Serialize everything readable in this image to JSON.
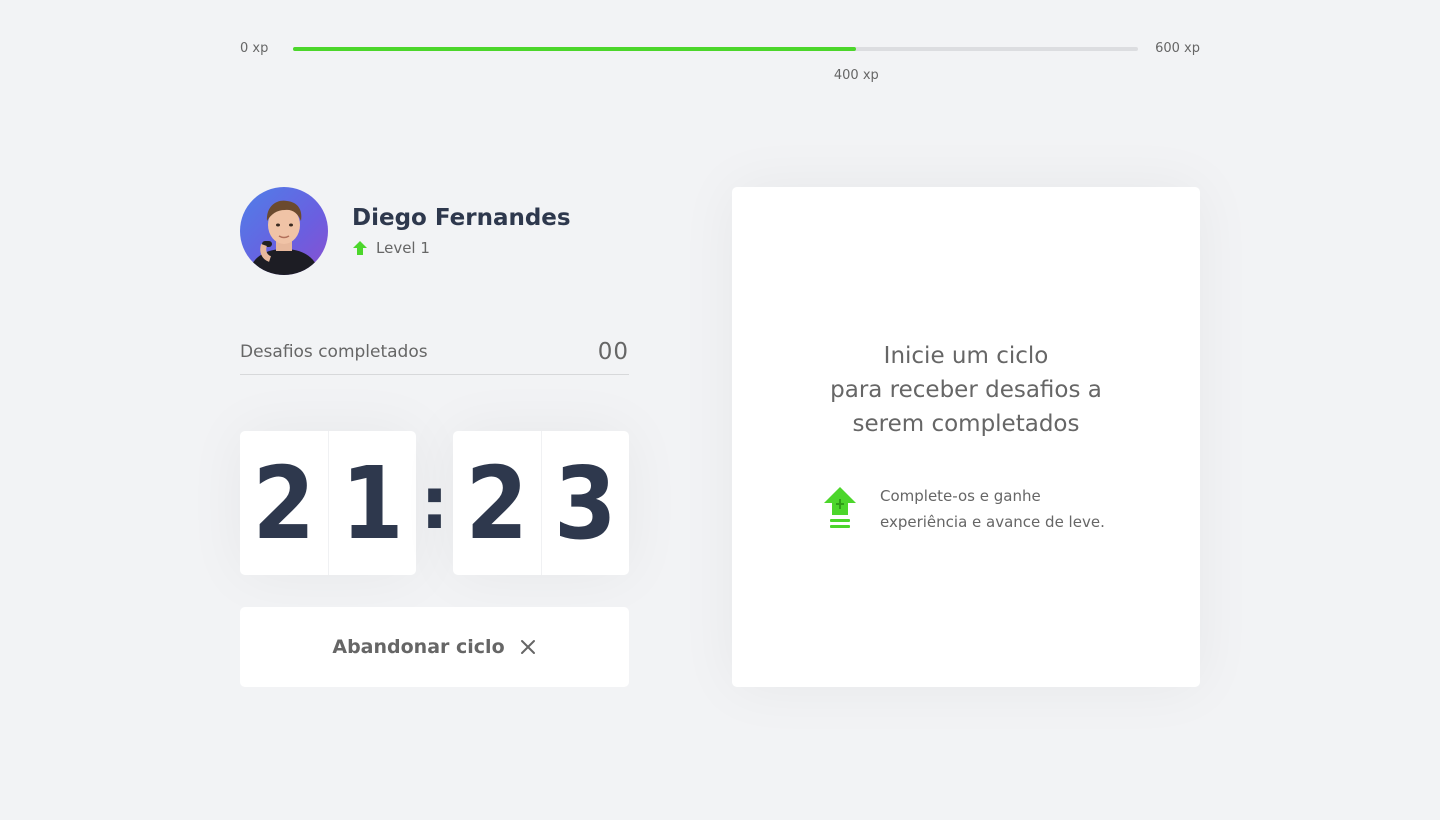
{
  "xp_bar": {
    "min_label": "0 xp",
    "max_label": "600 xp",
    "current_label": "400 xp",
    "current_xp": 400,
    "max_xp": 600,
    "progress_fraction": 0.6667,
    "fill_color": "#4cd62b"
  },
  "profile": {
    "name": "Diego Fernandes",
    "level_label": "Level 1",
    "level_icon": "level-up-arrow-icon"
  },
  "completed_challenges": {
    "label": "Desafios completados",
    "count": "00"
  },
  "countdown": {
    "minute_left": "2",
    "minute_right": "1",
    "separator": ":",
    "second_left": "2",
    "second_right": "3"
  },
  "abandon_button": {
    "label": "Abandonar ciclo",
    "icon": "close-icon"
  },
  "challenge_box": {
    "title": "Inicie um ciclo\npara receber desafios a\nserem completados",
    "hint": "Complete-os e ganhe experiência e avance de leve.",
    "hint_icon": "level-up-icon"
  },
  "colors": {
    "background": "#f2f3f5",
    "text": "#666666",
    "title": "#2e384d",
    "green": "#4cd62b",
    "white": "#ffffff"
  }
}
